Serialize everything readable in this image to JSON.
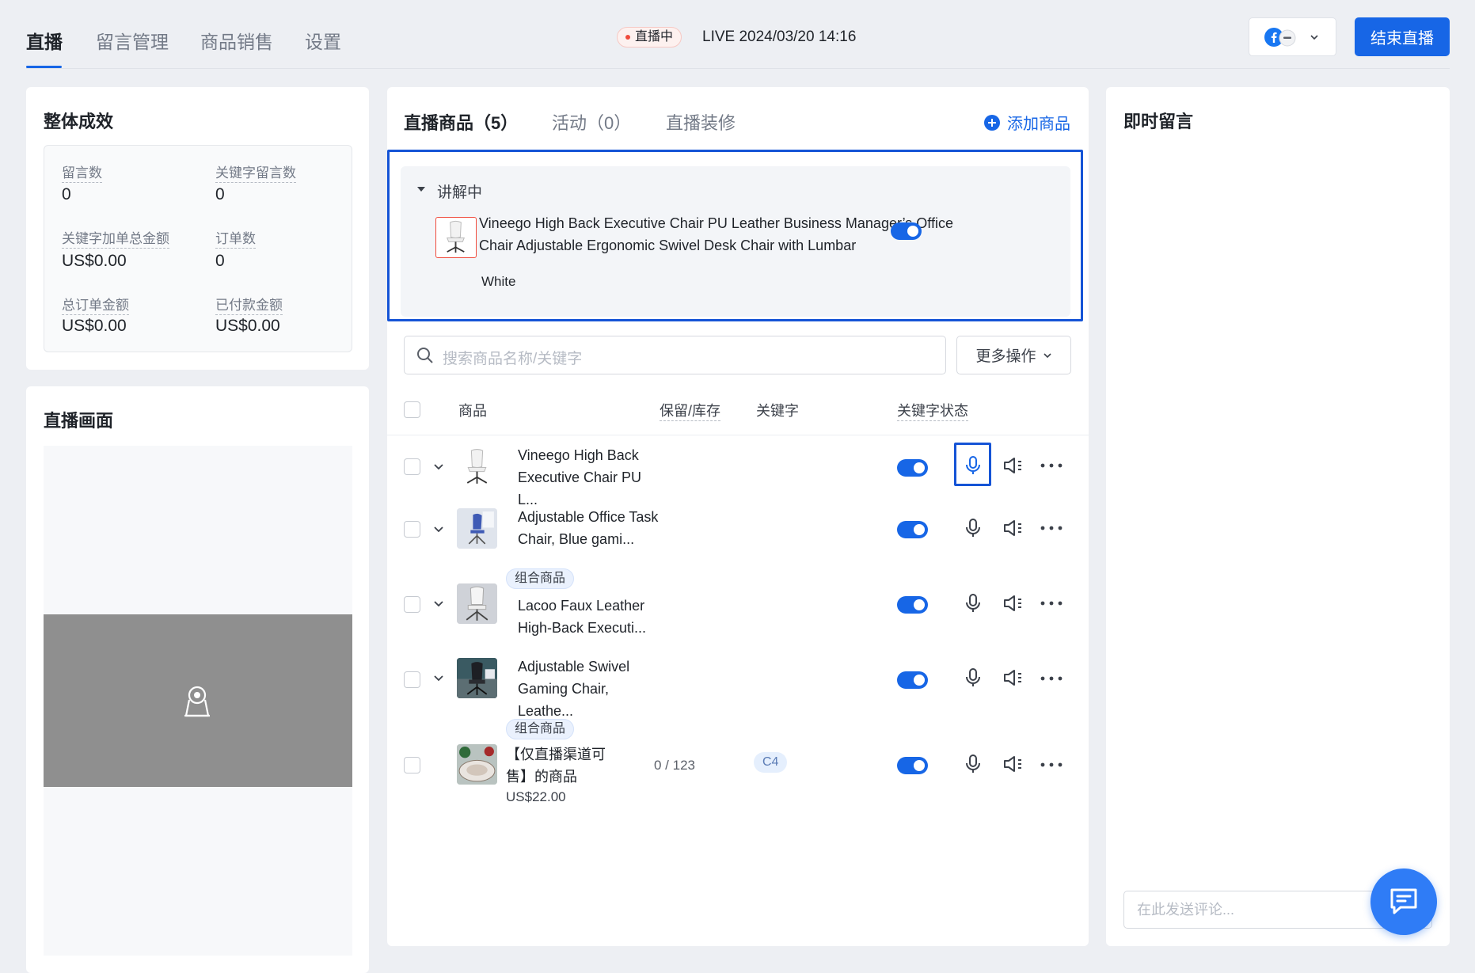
{
  "nav": {
    "tabs": [
      "直播",
      "留言管理",
      "商品销售",
      "设置"
    ],
    "active_index": 0
  },
  "header": {
    "live_badge": "直播中",
    "live_time": "LIVE 2024/03/20 14:16",
    "end_button": "结束直播"
  },
  "performance": {
    "title": "整体成效",
    "stats": [
      {
        "label": "留言数",
        "value": "0"
      },
      {
        "label": "关键字留言数",
        "value": "0"
      },
      {
        "label": "关键字加单总金额",
        "value": "US$0.00"
      },
      {
        "label": "订单数",
        "value": "0"
      },
      {
        "label": "总订单金额",
        "value": "US$0.00"
      },
      {
        "label": "已付款金额",
        "value": "US$0.00"
      }
    ]
  },
  "live_view": {
    "title": "直播画面"
  },
  "products_panel": {
    "tabs": [
      "直播商品（5）",
      "活动（0）",
      "直播装修"
    ],
    "add_label": "添加商品",
    "explaining": {
      "label": "讲解中",
      "product_name": "Vineego High Back Executive Chair PU Leather Business Manager’s Office Chair Adjustable Ergonomic Swivel Desk Chair with Lumbar",
      "variant": "White"
    },
    "search_placeholder": "搜索商品名称/关键字",
    "more_actions": "更多操作",
    "columns": [
      "商品",
      "保留/库存",
      "关键字",
      "关键字状态"
    ],
    "rows": [
      {
        "name": "Vineego High Back Executive Chair PU L...",
        "tag": "",
        "stock": "",
        "keyword": "",
        "price": "",
        "status_on": true
      },
      {
        "name": "Adjustable Office Task Chair, Blue gami...",
        "tag": "",
        "stock": "",
        "keyword": "",
        "price": "",
        "status_on": true
      },
      {
        "name": "Lacoo Faux Leather High-Back Executi...",
        "tag": "组合商品",
        "stock": "",
        "keyword": "",
        "price": "",
        "status_on": true
      },
      {
        "name": "Adjustable Swivel Gaming Chair, Leathe...",
        "tag": "",
        "stock": "",
        "keyword": "",
        "price": "",
        "status_on": true
      },
      {
        "name": "【仅直播渠道可售】的商品",
        "tag": "组合商品",
        "stock": "0 / 123",
        "keyword": "C4",
        "price": "US$22.00",
        "status_on": true
      }
    ]
  },
  "comments": {
    "title": "即时留言",
    "input_placeholder": "在此发送评论..."
  },
  "colors": {
    "accent": "#1766e6",
    "highlight": "#1554d6",
    "live_red": "#f04b3c"
  }
}
